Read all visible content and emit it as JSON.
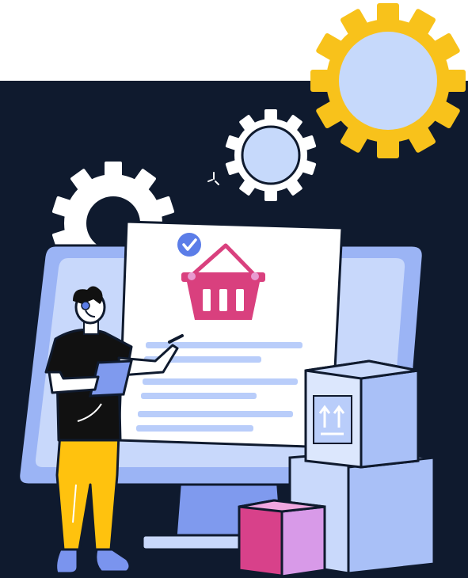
{
  "scene": {
    "description_icons": [
      "gear-icon",
      "basket-icon",
      "check-icon",
      "box-icon",
      "monitor-icon",
      "person-icon",
      "tablet-icon",
      "sparkle-icon"
    ],
    "colors": {
      "background_top": "#ffffff",
      "panel_dark": "#0f1a2e",
      "gear_yellow": "#f8c21b",
      "gear_fill_light": "#c6d9fb",
      "gear_white": "#ffffff",
      "monitor_blue": "#9bb4f5",
      "monitor_screen": "#c8d8fb",
      "document_white": "#ffffff",
      "document_lines": "#b9cdfa",
      "basket_pink": "#d9407e",
      "check_blue": "#5b7de8",
      "box_light": "#c9d9fb",
      "box_side": "#a9c0f7",
      "box_pink": "#d8418a",
      "box_pink_top": "#f0a8e0",
      "shirt_black": "#111111",
      "pants_yellow": "#ffc20e",
      "skin": "#ffffff",
      "shoe_blue": "#7a94ee",
      "outline": "#0f1a2e"
    }
  }
}
